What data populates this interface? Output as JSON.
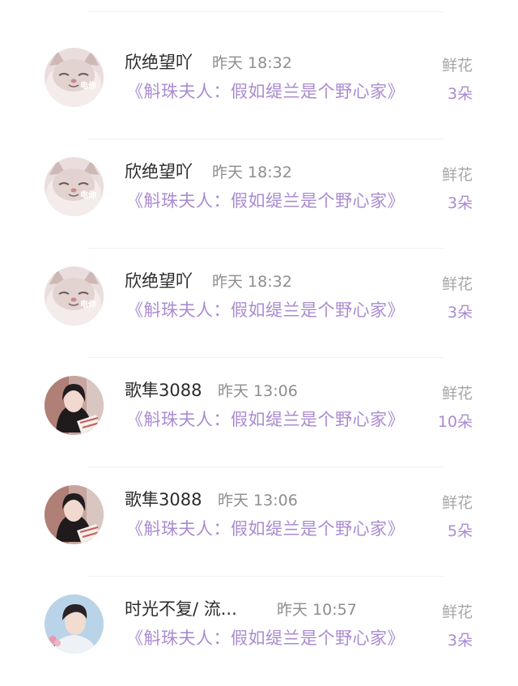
{
  "items": [
    {
      "avatar": "cat-avatar",
      "avatar_caption": "电你",
      "name": "欣绝望吖",
      "time": "昨天 18:32",
      "book": "《斛珠夫人：假如缇兰是个野心家》",
      "gift_label": "鲜花",
      "gift_count": "3朵"
    },
    {
      "avatar": "cat-avatar",
      "avatar_caption": "电你",
      "name": "欣绝望吖",
      "time": "昨天 18:32",
      "book": "《斛珠夫人：假如缇兰是个野心家》",
      "gift_label": "鲜花",
      "gift_count": "3朵"
    },
    {
      "avatar": "cat-avatar",
      "avatar_caption": "电你",
      "name": "欣绝望吖",
      "time": "昨天 18:32",
      "book": "《斛珠夫人：假如缇兰是个野心家》",
      "gift_label": "鲜花",
      "gift_count": "3朵"
    },
    {
      "avatar": "girl-avatar",
      "name": "歌隼3088",
      "time": "昨天 13:06",
      "book": "《斛珠夫人：假如缇兰是个野心家》",
      "gift_label": "鲜花",
      "gift_count": "10朵"
    },
    {
      "avatar": "girl-avatar",
      "name": "歌隼3088",
      "time": "昨天 13:06",
      "book": "《斛珠夫人：假如缇兰是个野心家》",
      "gift_label": "鲜花",
      "gift_count": "5朵"
    },
    {
      "avatar": "boy-avatar",
      "name": "时光不复/ 流...",
      "time": "昨天 10:57",
      "book": "《斛珠夫人：假如缇兰是个野心家》",
      "gift_label": "鲜花",
      "gift_count": "3朵"
    }
  ],
  "colors": {
    "name": "#2b2b2b",
    "time": "#8e8e8e",
    "book": "#a98bd1",
    "gift_label": "#a6a6a6",
    "gift_count": "#a98bd1"
  }
}
